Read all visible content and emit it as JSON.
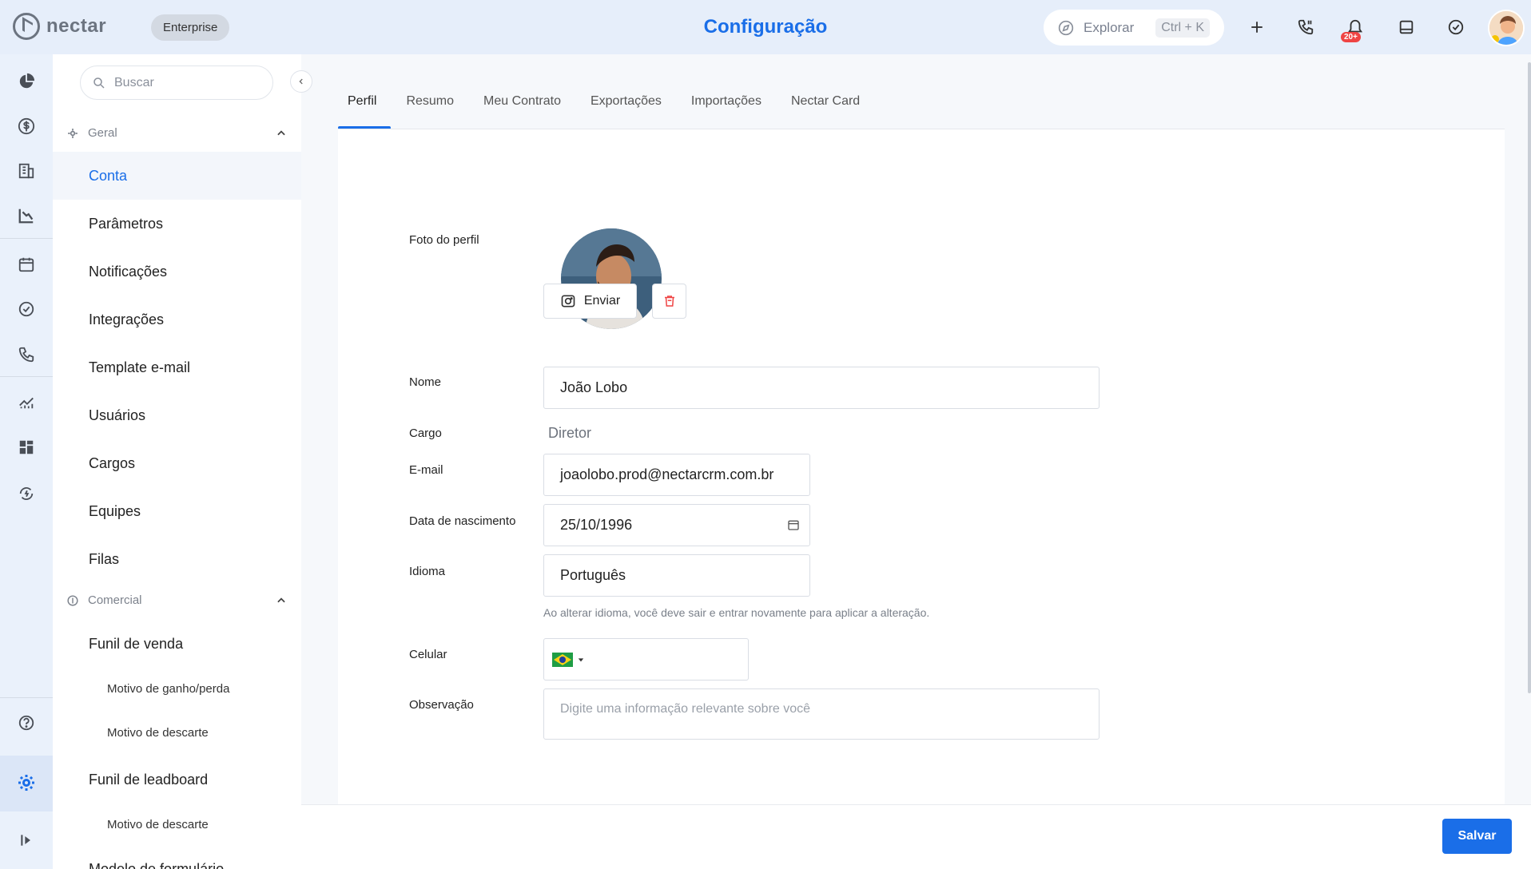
{
  "app": {
    "name": "nectar",
    "plan_badge": "Enterprise",
    "page_title": "Configuração"
  },
  "topbar": {
    "explore_label": "Explorar",
    "explore_shortcut": "Ctrl + K",
    "notification_count": "20+",
    "icons": [
      "compass-icon",
      "plus-icon",
      "phone-icon",
      "bell-icon",
      "inbox-icon",
      "check-circle-icon",
      "avatar"
    ]
  },
  "rail": {
    "icons": [
      "pie-chart-icon",
      "dollar-icon",
      "building-icon",
      "chart-down-icon",
      "calendar-icon",
      "check-circle-icon",
      "phone-icon",
      "chart-up-icon",
      "dashboard-icon",
      "sync-icon",
      "help-icon",
      "gear-icon",
      "expand-icon"
    ]
  },
  "sidebar": {
    "search_placeholder": "Buscar",
    "sections": [
      {
        "label": "Geral",
        "items": [
          "Conta",
          "Parâmetros",
          "Notificações",
          "Integrações",
          "Template e-mail",
          "Usuários",
          "Cargos",
          "Equipes",
          "Filas"
        ]
      },
      {
        "label": "Comercial",
        "items": [
          "Funil de venda",
          "Motivo de ganho/perda",
          "Motivo de descarte",
          "Funil de leadboard",
          "Motivo de descarte",
          "Modelo de formulário"
        ]
      }
    ]
  },
  "tabs": [
    "Perfil",
    "Resumo",
    "Meu Contrato",
    "Exportações",
    "Importações",
    "Nectar Card"
  ],
  "form": {
    "photo_label": "Foto do perfil",
    "send_button": "Enviar",
    "name_label": "Nome",
    "name_value": "João Lobo",
    "role_label": "Cargo",
    "role_value": "Diretor",
    "email_label": "E-mail",
    "email_value": "joaolobo.prod@nectarcrm.com.br",
    "birth_label": "Data de nascimento",
    "birth_value": "25/10/1996",
    "language_label": "Idioma",
    "language_value": "Português",
    "language_hint": "Ao alterar idioma, você deve sair e entrar novamente para aplicar a alteração.",
    "phone_label": "Celular",
    "notes_label": "Observação",
    "notes_placeholder": "Digite uma informação relevante sobre você"
  },
  "footer": {
    "save_button": "Salvar"
  },
  "colors": {
    "accent": "#1a6ee8",
    "danger": "#ef4444"
  }
}
